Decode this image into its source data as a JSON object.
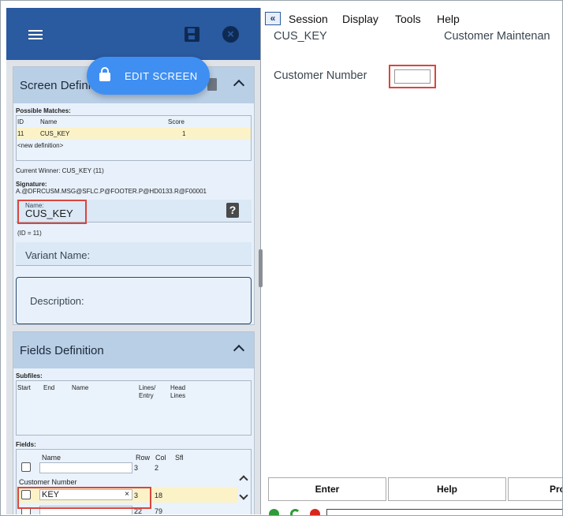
{
  "edit_screen_label": "EDIT SCREEN",
  "screen_definition": {
    "title": "Screen Definiti",
    "possible_matches_label": "Possible Matches:",
    "columns": [
      "ID",
      "Name",
      "Score"
    ],
    "rows": [
      {
        "id": "11",
        "name": "CUS_KEY",
        "score": "1"
      },
      {
        "id": "",
        "name": "<new definition>",
        "score": ""
      }
    ],
    "current_winner": "Current Winner: CUS_KEY (11)",
    "signature_label": "Signature:",
    "signature": "A.@DFRCUSM.MSG@SFLC.P@FOOTER.P@HD0133.R@F00001",
    "name_label": "Name:",
    "name_value": "CUS_KEY",
    "id_note": "(ID = 11)",
    "variant_label": "Variant Name:",
    "description_label": "Description:"
  },
  "fields_definition": {
    "title": "Fields Definition",
    "subfiles_label": "Subfiles:",
    "subfile_columns": [
      "Start",
      "End",
      "Name",
      "Lines/",
      "Entry",
      "Head",
      "Lines"
    ],
    "fields_label": "Fields:",
    "field_columns": [
      "Name",
      "Row",
      "Col",
      "Sfl"
    ],
    "rows": [
      {
        "row": "3",
        "col": "2",
        "value": ""
      },
      {
        "row": "3",
        "col": "18",
        "value": "KEY"
      },
      {
        "row": "22",
        "col": "79",
        "value": ""
      }
    ],
    "group_label": "Customer Number"
  },
  "menu": {
    "back_glyph": "«",
    "items": [
      "Session",
      "Display",
      "Tools",
      "Help"
    ]
  },
  "screen": {
    "program_name": "CUS_KEY",
    "screen_title": "Customer Maintenan",
    "field_label": "Customer Number"
  },
  "function_keys": [
    "Enter",
    "Help",
    "Pro"
  ],
  "colors": {
    "header_blue": "#2a5aa0",
    "accent_button": "#3f8ff2",
    "highlight_red": "#d9463e",
    "selected_row": "#fbf2c8"
  }
}
